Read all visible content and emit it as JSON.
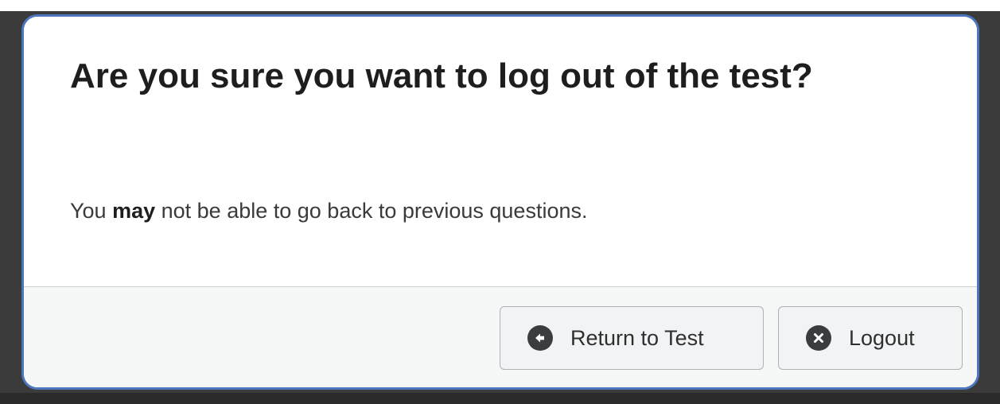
{
  "dialog": {
    "title": "Are you sure you want to log out of the test?",
    "message_prefix": "You ",
    "message_emphasis": "may",
    "message_suffix": " not be able to go back to previous questions.",
    "buttons": {
      "return_label": "Return to Test",
      "return_icon": "arrow-left-circle-icon",
      "logout_label": "Logout",
      "logout_icon": "x-circle-icon"
    }
  },
  "colors": {
    "border_accent": "#4c77bf",
    "icon_fill": "#3a3c3f",
    "footer_bg": "#f6f7f7"
  }
}
